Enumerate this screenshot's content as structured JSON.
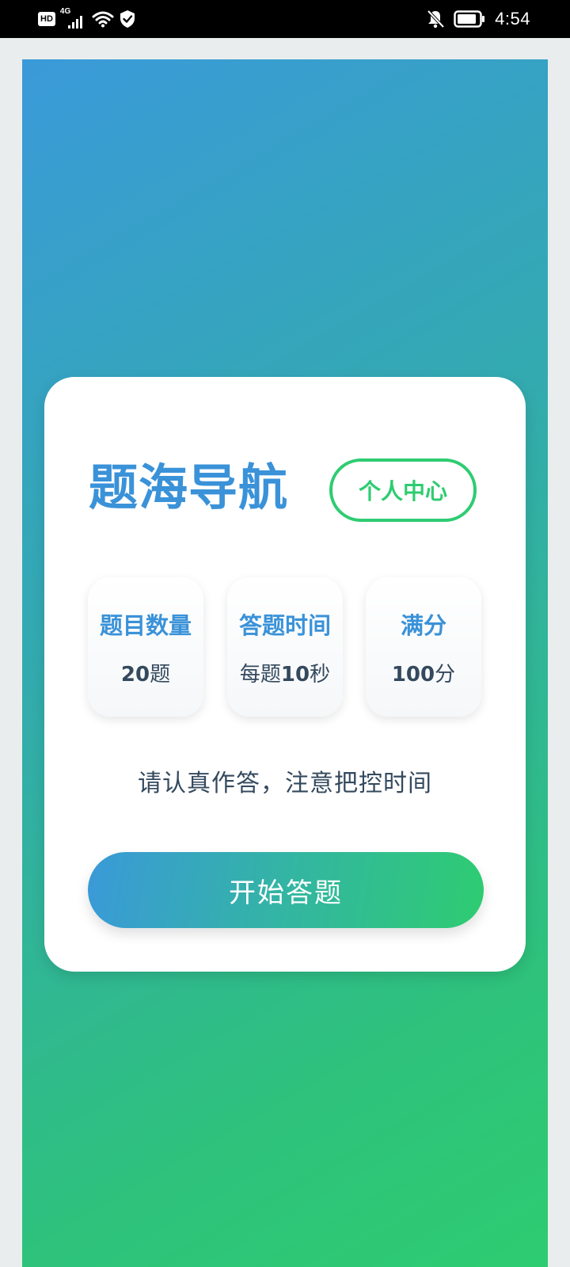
{
  "status_bar": {
    "hd_label": "HD",
    "network_label": "4G",
    "time": "4:54",
    "icons": [
      "hd-icon",
      "cellular-signal-icon",
      "wifi-icon",
      "shield-icon",
      "notifications-off-icon",
      "battery-icon"
    ]
  },
  "home": {
    "title": "题海导航",
    "profile_button": "个人中心",
    "stats": [
      {
        "label": "题目数量",
        "value_number": "20",
        "value_unit": "题",
        "value_prefix": ""
      },
      {
        "label": "答题时间",
        "value_prefix": "每题",
        "value_number": "10",
        "value_unit": "秒"
      },
      {
        "label": "满分",
        "value_prefix": "",
        "value_number": "100",
        "value_unit": "分"
      }
    ],
    "notice": "请认真作答，注意把控时间",
    "start_button": "开始答题"
  },
  "colors": {
    "primary_blue": "#3a92d8",
    "accent_green": "#2ecc71",
    "text_dark": "#34495e",
    "page_bg": "#e9eded"
  }
}
